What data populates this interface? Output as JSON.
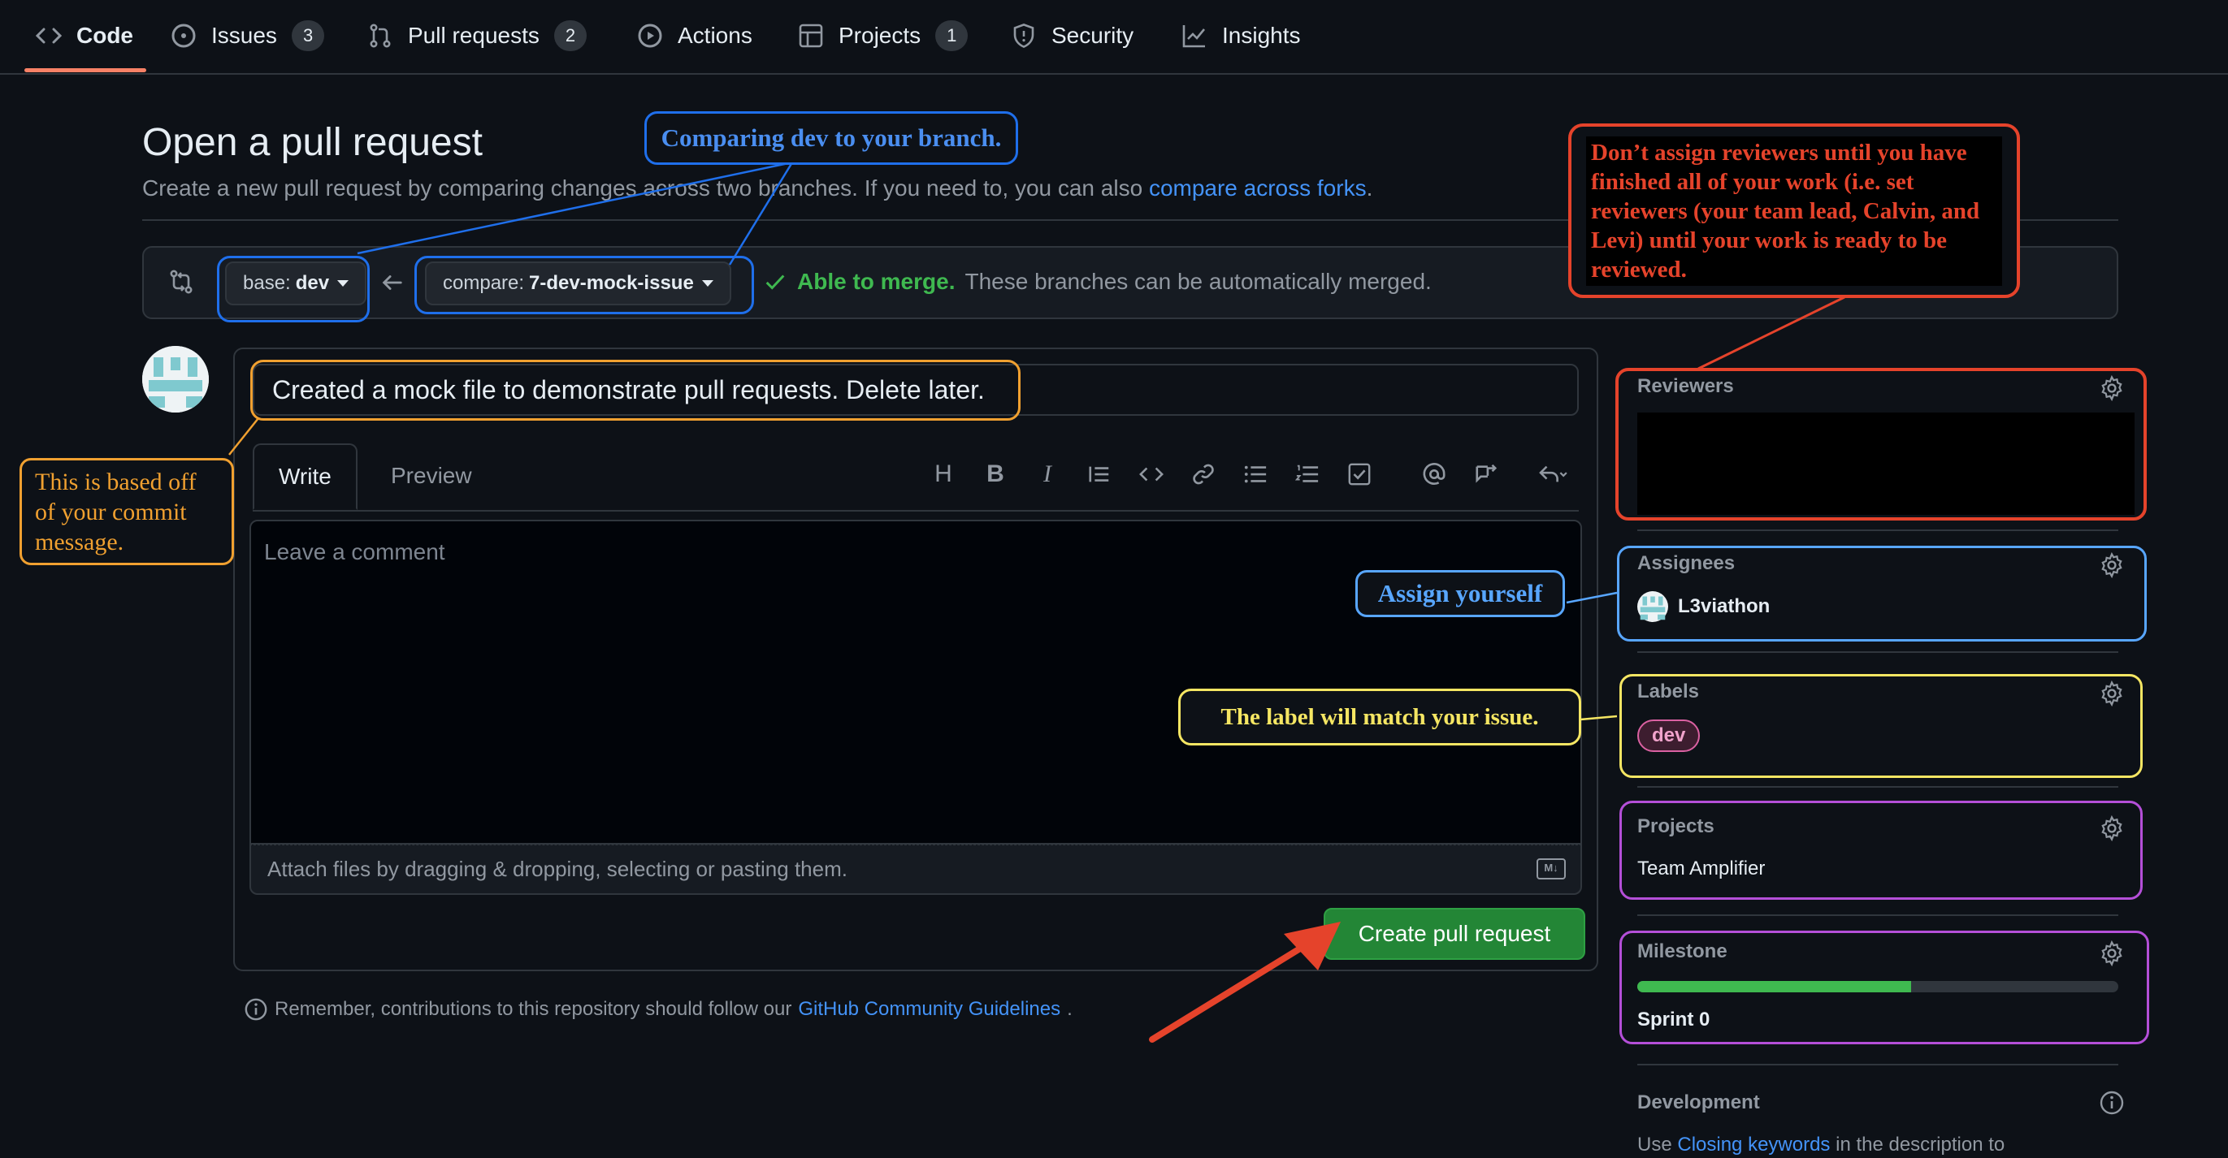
{
  "nav": {
    "tabs": [
      {
        "label": "Code",
        "icon": "code-icon"
      },
      {
        "label": "Issues",
        "count": "3",
        "icon": "issue-icon"
      },
      {
        "label": "Pull requests",
        "count": "2",
        "icon": "pull-request-icon"
      },
      {
        "label": "Actions",
        "icon": "play-icon"
      },
      {
        "label": "Projects",
        "count": "1",
        "icon": "table-icon"
      },
      {
        "label": "Security",
        "icon": "shield-icon"
      },
      {
        "label": "Insights",
        "icon": "graph-icon"
      }
    ]
  },
  "page": {
    "title": "Open a pull request",
    "subtitle": "Create a new pull request by comparing changes across two branches. If you need to, you can also",
    "subtitle_link": "compare across forks",
    "subtitle_end": "."
  },
  "branches": {
    "base_prefix": "base:",
    "base": "dev",
    "compare_prefix": "compare:",
    "compare": "7-dev-mock-issue",
    "merge_status": "Able to merge.",
    "merge_detail": "These branches can be automatically merged."
  },
  "editor": {
    "title_value": "Created a mock file to demonstrate pull requests. Delete later.",
    "tab_write": "Write",
    "tab_preview": "Preview",
    "toolbar": [
      "H",
      "B",
      "I"
    ],
    "comment_placeholder": "Leave a comment",
    "attach_hint": "Attach files by dragging & dropping, selecting or pasting them.",
    "create_button": "Create pull request"
  },
  "footer": {
    "remember": "Remember, contributions to this repository should follow our",
    "link": "GitHub Community Guidelines",
    "end": "."
  },
  "sidebar": {
    "reviewers_label": "Reviewers",
    "assignees_label": "Assignees",
    "assignee_name": "L3viathon",
    "labels_label": "Labels",
    "label_value": "dev",
    "projects_label": "Projects",
    "project_name": "Team Amplifier",
    "milestone_label": "Milestone",
    "milestone_name": "Sprint 0",
    "milestone_progress": 0.57,
    "development_label": "Development",
    "development_text_pre": "Use",
    "development_link": "Closing keywords",
    "development_text_post": "in the description to"
  },
  "annotations": {
    "comparing": "Comparing dev to your branch.",
    "commit_msg": "This is based off of your commit message.",
    "reviewers_note": "Don’t assign reviewers until you have finished all of your work (i.e. set reviewers (your team lead, Calvin, and Levi) until your work is ready to be reviewed.",
    "assign_yourself": "Assign yourself",
    "label_note": "The label will match your issue."
  },
  "colors": {
    "bg": "#0d1117",
    "accent": "#4493f8",
    "green": "#238636",
    "note_blue": "#1f6feb",
    "note_orange": "#f0a030",
    "note_red": "#e5432b",
    "note_yellow": "#f5e663",
    "note_purple": "#b44fd8"
  }
}
